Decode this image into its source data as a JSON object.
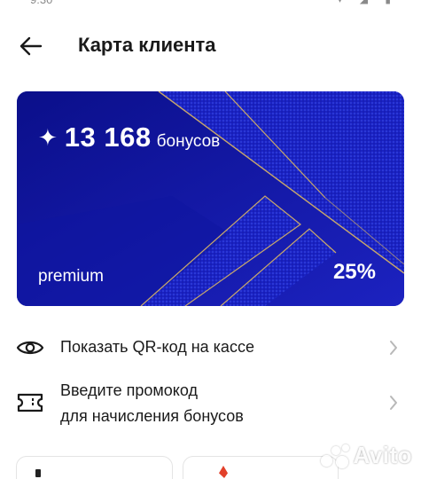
{
  "header": {
    "title": "Карта клиента",
    "back_icon": "arrow-left-icon"
  },
  "card": {
    "bonus_icon": "sparkle-icon",
    "bonus_star": "✦",
    "bonus_amount": "13 168",
    "bonus_unit": "бонусов",
    "level": "premium",
    "discount": "25%",
    "colors": {
      "base": "#1418a8",
      "accent_gold": "#c9a86a",
      "pattern": "#2b3fd6"
    }
  },
  "actions": [
    {
      "label": "Показать QR-код на кассе",
      "icon": "eye-icon"
    },
    {
      "label_line1": "Введите промокод",
      "label_line2": "для начисления бонусов",
      "icon": "ticket-icon"
    }
  ],
  "watermark": {
    "text": "Avito"
  }
}
